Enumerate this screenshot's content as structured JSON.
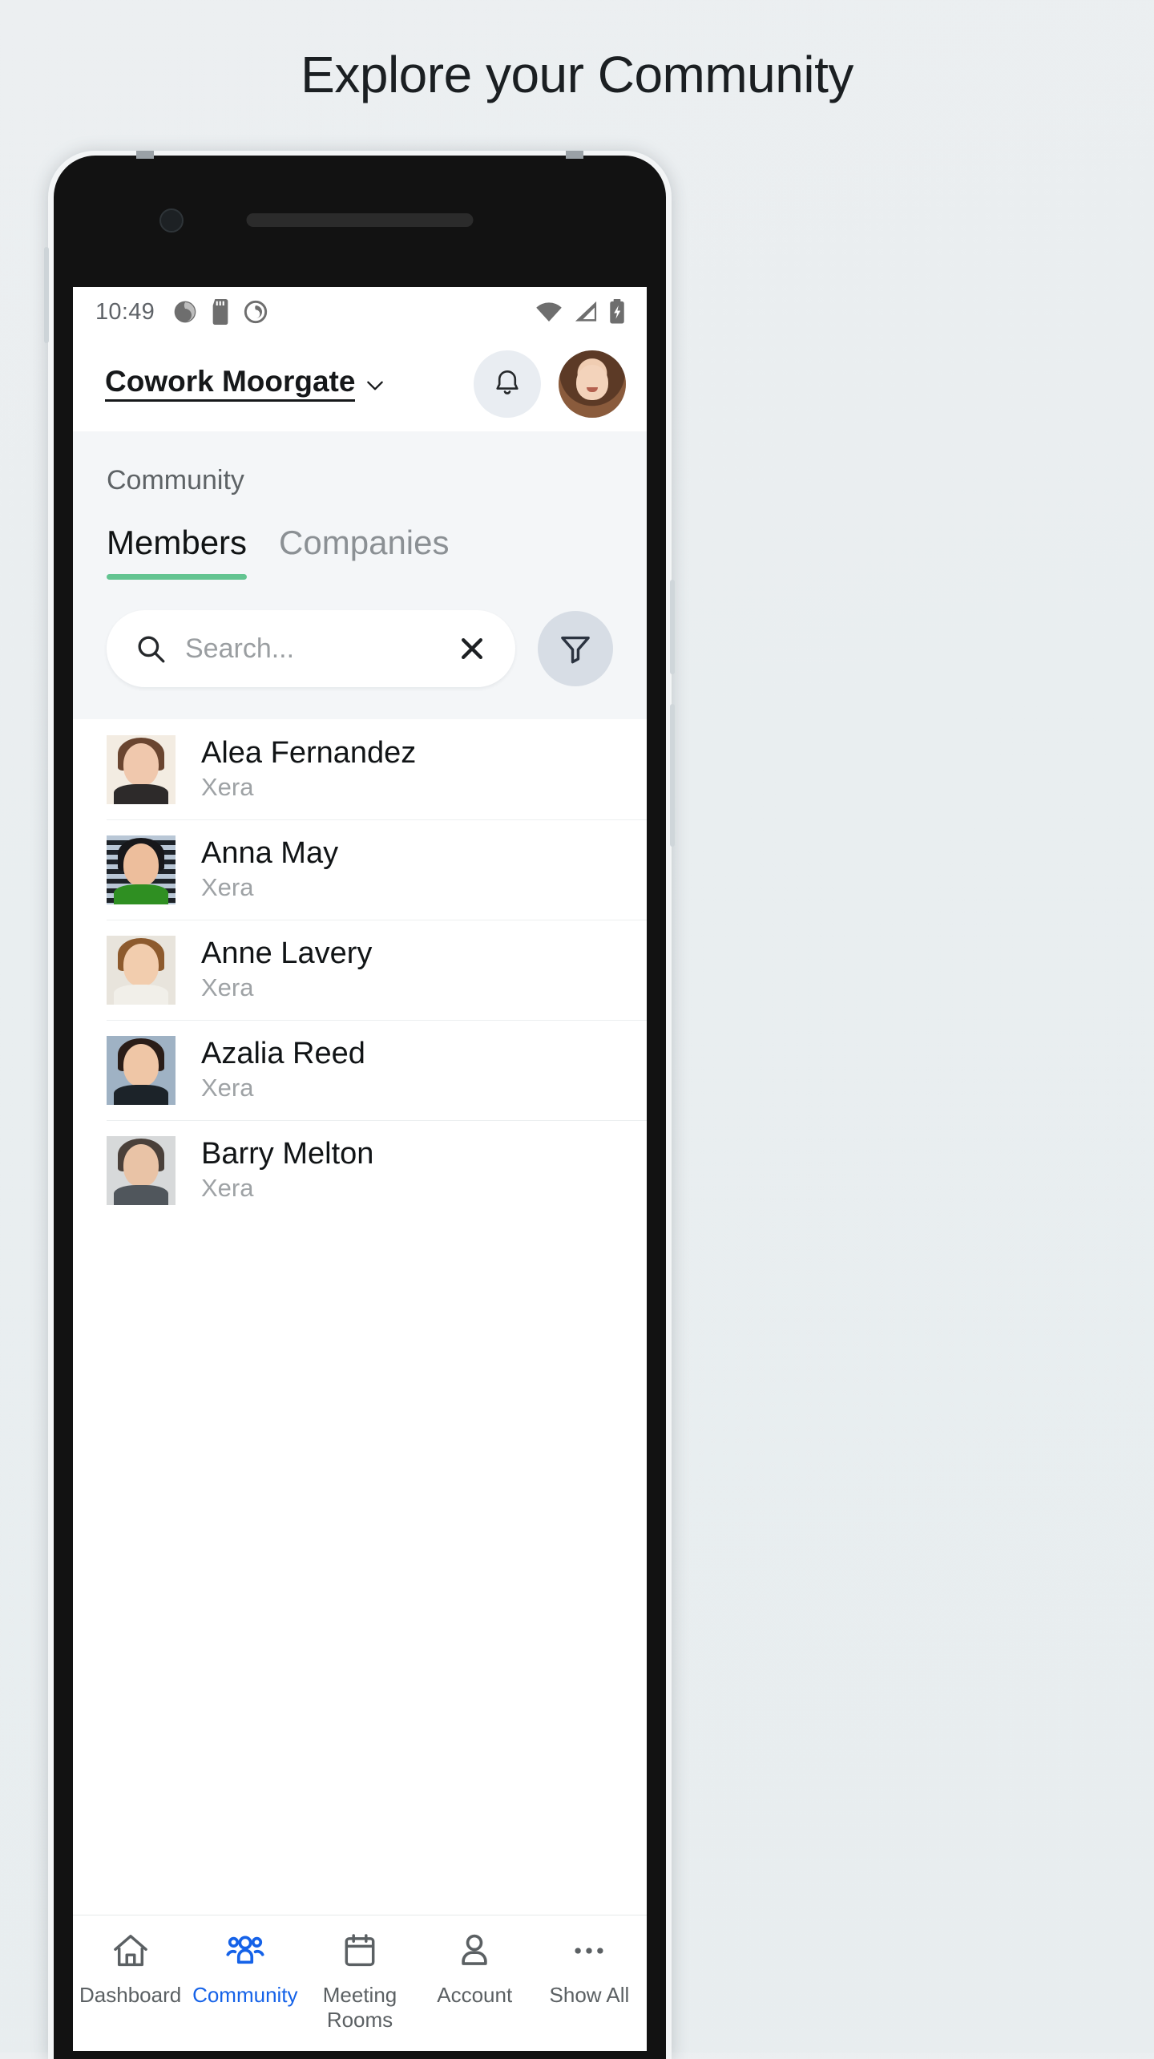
{
  "page": {
    "title": "Explore your Community"
  },
  "theme": {
    "accent_green": "#63c491",
    "accent_blue": "#1562e8",
    "screen_bg": "#ffffff",
    "subhead_bg": "#f4f6f8"
  },
  "statusbar": {
    "time": "10:49",
    "left_icons": [
      "app-badge-icon",
      "sd-card-icon",
      "do-not-disturb-icon"
    ],
    "right_icons": [
      "wifi-icon",
      "cellular-signal-icon",
      "battery-charging-icon"
    ]
  },
  "header": {
    "venue_name": "Cowork Moorgate",
    "venue_chevron": "chevron-down-icon",
    "notifications_icon": "bell-icon",
    "avatar_label": "user-avatar"
  },
  "main": {
    "section_label": "Community",
    "tabs": [
      {
        "label": "Members",
        "active": true
      },
      {
        "label": "Companies",
        "active": false
      }
    ],
    "search": {
      "placeholder": "Search...",
      "value": "",
      "search_icon": "search-icon",
      "clear_icon": "close-icon"
    },
    "filter": {
      "icon": "filter-funnel-icon"
    },
    "members": [
      {
        "name": "Alea Fernandez",
        "company": "Xera"
      },
      {
        "name": "Anna May",
        "company": "Xera"
      },
      {
        "name": "Anne Lavery",
        "company": "Xera"
      },
      {
        "name": "Azalia Reed",
        "company": "Xera"
      },
      {
        "name": "Barry Melton",
        "company": "Xera"
      }
    ]
  },
  "bottom_nav": [
    {
      "label": "Dashboard",
      "icon": "home-icon",
      "active": false
    },
    {
      "label": "Community",
      "icon": "people-group-icon",
      "active": true
    },
    {
      "label": "Meeting\nRooms",
      "icon": "calendar-icon",
      "active": false
    },
    {
      "label": "Account",
      "icon": "person-icon",
      "active": false
    },
    {
      "label": "Show All",
      "icon": "ellipsis-icon",
      "active": false
    }
  ]
}
